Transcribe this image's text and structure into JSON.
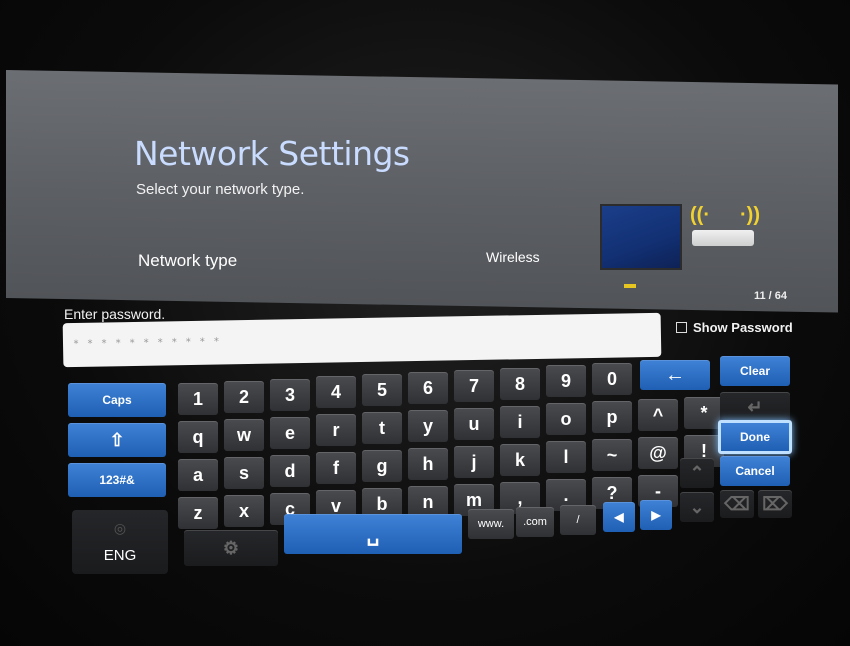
{
  "settings": {
    "title": "Network Settings",
    "subtitle": "Select your network type.",
    "network_type_label": "Network type",
    "network_type_value": "Wireless"
  },
  "keyboard": {
    "prompt": "Enter password.",
    "counter": "11 / 64",
    "password_masked": "* * * * * * * * * * *",
    "show_password_label": "Show Password",
    "show_password_checked": false,
    "accent_color": "#2f6fc4",
    "left_keys": {
      "caps": "Caps",
      "shift_icon": "⇧",
      "symbols": "123#&",
      "language": "ENG"
    },
    "number_row": [
      "1",
      "2",
      "3",
      "4",
      "5",
      "6",
      "7",
      "8",
      "9",
      "0"
    ],
    "row_q": [
      "q",
      "w",
      "e",
      "r",
      "t",
      "y",
      "u",
      "i",
      "o",
      "p",
      "^",
      "*"
    ],
    "row_a": [
      "a",
      "s",
      "d",
      "f",
      "g",
      "h",
      "j",
      "k",
      "l",
      "~",
      "@",
      "!"
    ],
    "row_z": [
      "z",
      "x",
      "c",
      "v",
      "b",
      "n",
      "m",
      ",",
      ".",
      "?",
      "-"
    ],
    "bottom_row": {
      "space_icon": "␣",
      "www": "www.",
      "com": ".com",
      "slash": "/",
      "left_arrow": "◀",
      "right_arrow": "▶"
    },
    "action_keys": {
      "backspace_icon": "←",
      "clear": "Clear",
      "done": "Done",
      "cancel": "Cancel"
    }
  }
}
